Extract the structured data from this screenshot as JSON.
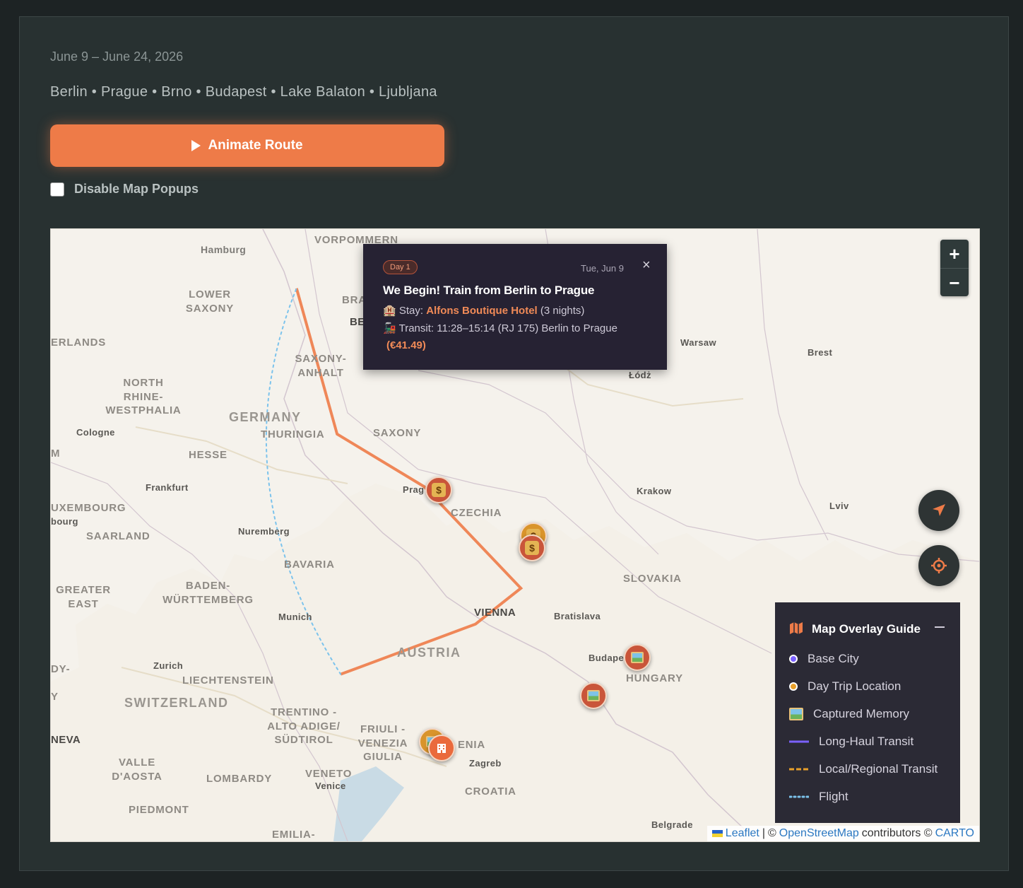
{
  "trip": {
    "dates": "June 9 – June 24, 2026",
    "cities": "Berlin • Prague • Brno • Budapest • Lake Balaton • Ljubljana"
  },
  "controls": {
    "animate_label": "Animate Route",
    "disable_popups_label": "Disable Map Popups",
    "disable_popups_checked": false
  },
  "map": {
    "zoom_in": "+",
    "zoom_out": "−",
    "labels": {
      "hamburg": "Hamburg",
      "vorpommern": "VORPOMMERN",
      "lower_saxony": "LOWER SAXONY",
      "erlands": "ERLANDS",
      "bra": "BRA",
      "be": "BE",
      "saxony_anhalt": "SAXONY- ANHALT",
      "north_rhine": "NORTH RHINE- WESTPHALIA",
      "germany": "GERMANY",
      "thuringia": "THURINGIA",
      "saxony": "SAXONY",
      "cologne": "Cologne",
      "hesse": "HESSE",
      "frankfurt": "Frankfurt",
      "luxembourg": "UXEMBOURG",
      "bourg": "bourg",
      "saarland": "SAARLAND",
      "nuremberg": "Nuremberg",
      "bavaria": "BAVARIA",
      "greater_east": "GREATER EAST",
      "baden": "BADEN- WÜRTTEMBERG",
      "munich": "Munich",
      "vienna": "VIENNA",
      "bratislava": "Bratislava",
      "austria": "AUSTRIA",
      "zurich": "Zurich",
      "liechtenstein": "LIECHTENSTEIN",
      "switzerland": "SWITZERLAND",
      "trentino": "TRENTINO - ALTO ADIGE/ SÜDTIROL",
      "friuli": "FRIULI - VENEZIA GIULIA",
      "neva": "NEVA",
      "valle": "VALLE D'AOSTA",
      "lombardy": "LOMBARDY",
      "veneto": "VENETO",
      "venice": "Venice",
      "piedmont": "PIEDMONT",
      "emilia": "EMILIA-",
      "zagreb": "Zagreb",
      "croatia": "CROATIA",
      "enia": "ENIA",
      "hungary": "HUNGARY",
      "budapest": "Budape",
      "slovakia": "SLOVAKIA",
      "czechia": "CZECHIA",
      "prague": "Prag",
      "krakow": "Krakow",
      "lodz": "Łódż",
      "warsaw": "Warsaw",
      "brest": "Brest",
      "lviv": "Lviv",
      "belgrade": "Belgrade",
      "dy": "DY-",
      "m": "M",
      "y": "Y"
    },
    "route": [
      {
        "name": "Berlin",
        "lon": 13.4,
        "lat": 52.52
      },
      {
        "name": "Prague",
        "lon": 14.42,
        "lat": 50.08
      },
      {
        "name": "Brno",
        "lon": 16.61,
        "lat": 49.2
      },
      {
        "name": "Budapest",
        "lon": 19.04,
        "lat": 47.5
      },
      {
        "name": "Lake Balaton",
        "lon": 17.9,
        "lat": 46.9
      },
      {
        "name": "Ljubljana",
        "lon": 14.51,
        "lat": 46.06
      }
    ],
    "flight": [
      {
        "lon": 14.51,
        "lat": 46.06
      },
      {
        "lon": 13.4,
        "lat": 52.52
      }
    ],
    "markers": [
      {
        "name": "Prague",
        "kind": "money",
        "color": "#c9553a"
      },
      {
        "name": "Brno day trip",
        "kind": "money",
        "color": "#d9942b"
      },
      {
        "name": "Brno",
        "kind": "money",
        "color": "#c9553a"
      },
      {
        "name": "Budapest",
        "kind": "memory",
        "color": "#c9553a"
      },
      {
        "name": "Lake Balaton",
        "kind": "memory",
        "color": "#c9553a"
      },
      {
        "name": "Ljubljana day trip",
        "kind": "memory",
        "color": "#d9942b"
      },
      {
        "name": "Ljubljana",
        "kind": "hotel",
        "color": "#ea6a3c"
      }
    ],
    "route_color": "#ee7b48",
    "flight_color": "#7cc3ec"
  },
  "popup": {
    "day": "Day 1",
    "date": "Tue, Jun 9",
    "close": "×",
    "title": "We Begin! Train from Berlin to Prague",
    "stay_prefix": "Stay:",
    "hotel": "Alfons Boutique Hotel",
    "nights": "(3 nights)",
    "transit_prefix": "Transit: 11:28–15:14 (RJ 175) Berlin to Prague",
    "price": "(€41.49)"
  },
  "legend": {
    "title": "Map Overlay Guide",
    "items": [
      {
        "label": "Base City",
        "color": "#7b61ff",
        "kind": "dot"
      },
      {
        "label": "Day Trip Location",
        "color": "#e8a02a",
        "kind": "dot"
      },
      {
        "label": "Captured Memory",
        "kind": "memory"
      },
      {
        "label": "Long-Haul Transit",
        "color": "#7b61ff",
        "kind": "solid"
      },
      {
        "label": "Local/Regional Transit",
        "color": "#e8a02a",
        "kind": "dashed"
      },
      {
        "label": "Flight",
        "color": "#7cc3ec",
        "kind": "dotted"
      }
    ]
  },
  "attribution": {
    "leaflet": "Leaflet",
    "sep": "|",
    "copy1": "©",
    "osm": "OpenStreetMap",
    "contributors": "contributors ©",
    "carto": "CARTO"
  }
}
